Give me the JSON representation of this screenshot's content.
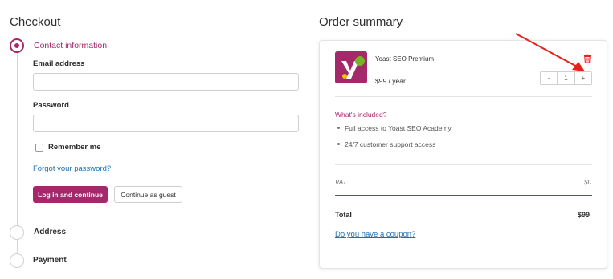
{
  "checkout": {
    "title": "Checkout",
    "steps": {
      "contact": "Contact information",
      "address": "Address",
      "payment": "Payment"
    },
    "email_label": "Email address",
    "email_value": "",
    "password_label": "Password",
    "password_value": "",
    "remember_label": "Remember me",
    "remember_checked": false,
    "forgot_link": "Forgot your password?",
    "login_button": "Log in and continue",
    "guest_button": "Continue as guest"
  },
  "summary": {
    "title": "Order summary",
    "product": {
      "name": "Yoast SEO Premium",
      "price": "$99 / year",
      "quantity": "1",
      "minus": "-",
      "plus": "+",
      "icon": "yoast-logo"
    },
    "included_title": "What's included?",
    "included_items": [
      "Full access to Yoast SEO Academy",
      "24/7 customer support access"
    ],
    "vat_label": "VAT",
    "vat_value": "$0",
    "total_label": "Total",
    "total_value": "$99",
    "coupon_link": "Do you have a coupon?"
  },
  "colors": {
    "accent": "#a4286a",
    "link": "#1f6fb0",
    "annotation_arrow": "#e8201b"
  }
}
